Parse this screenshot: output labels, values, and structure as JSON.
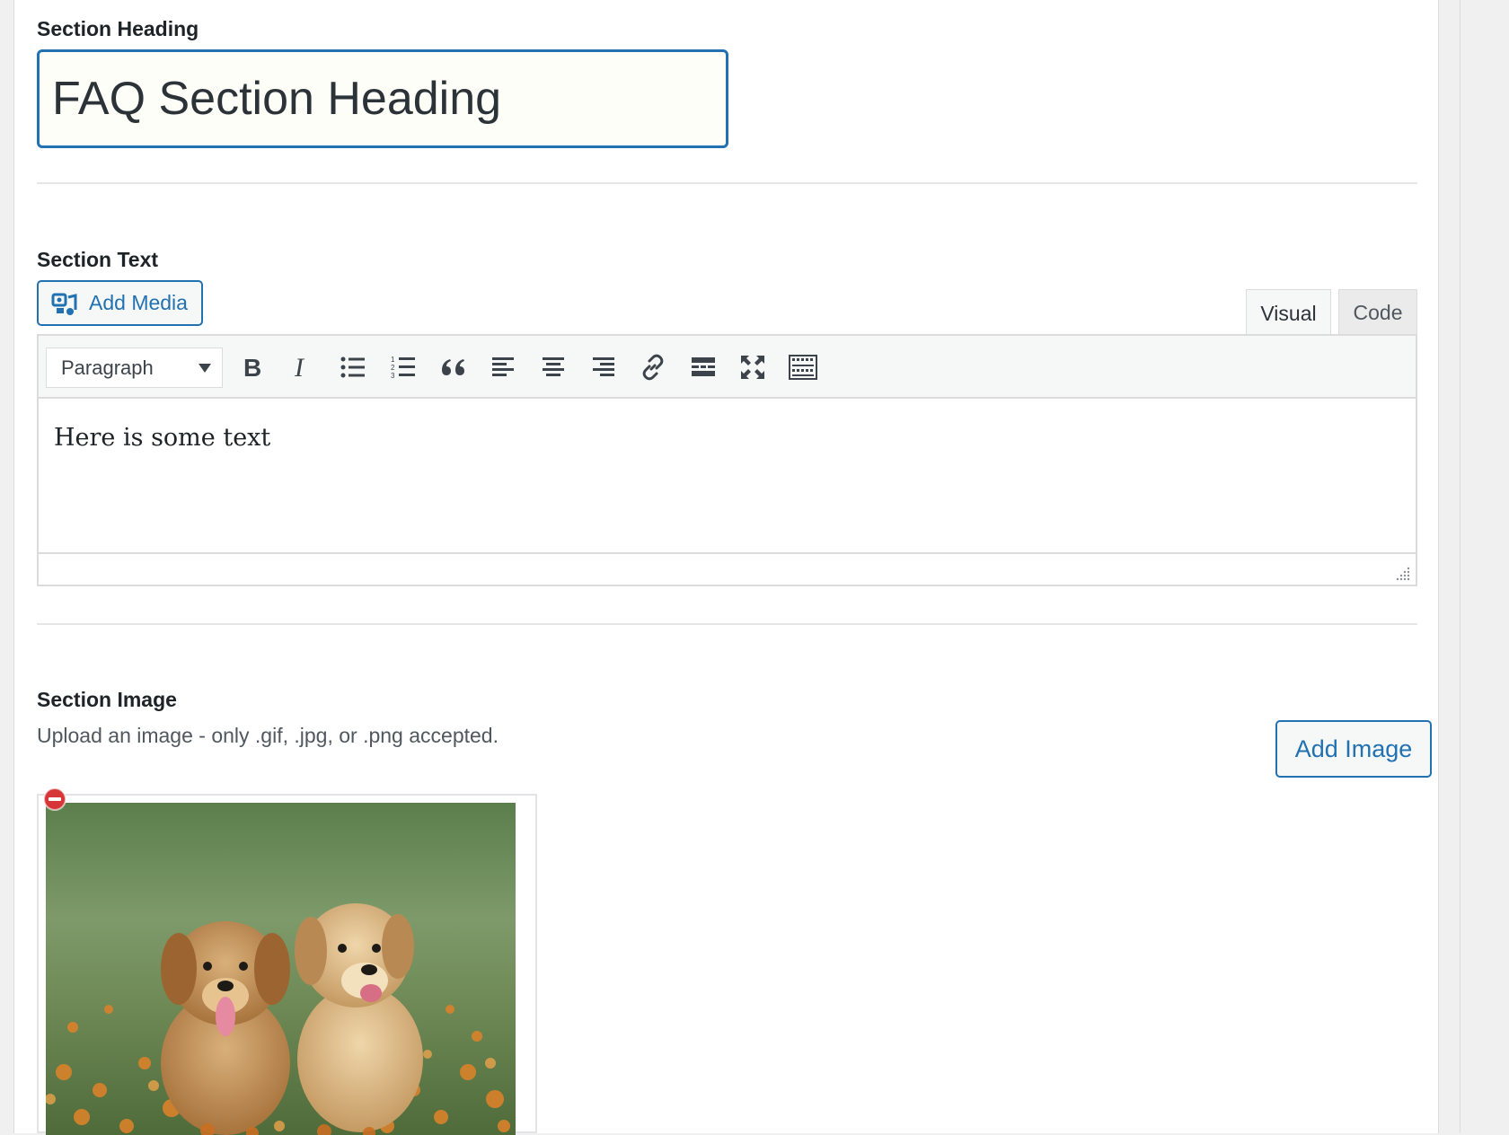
{
  "section_heading": {
    "label": "Section Heading",
    "value": "FAQ Section Heading"
  },
  "section_text": {
    "label": "Section Text",
    "add_media_label": "Add Media",
    "tabs": [
      {
        "label": "Visual",
        "active": true
      },
      {
        "label": "Code",
        "active": false
      }
    ],
    "toolbar": {
      "format_value": "Paragraph",
      "buttons": [
        "bold-icon",
        "italic-icon",
        "bulleted-list-icon",
        "numbered-list-icon",
        "blockquote-icon",
        "align-left-icon",
        "align-center-icon",
        "align-right-icon",
        "link-icon",
        "read-more-icon",
        "fullscreen-icon",
        "toolbar-toggle-icon"
      ]
    },
    "content": "Here is some text"
  },
  "section_image": {
    "label": "Section Image",
    "help": "Upload an image - only .gif, .jpg, or .png accepted.",
    "add_image_label": "Add Image"
  },
  "colors": {
    "accent": "#2271b1",
    "remove": "#d63638"
  }
}
